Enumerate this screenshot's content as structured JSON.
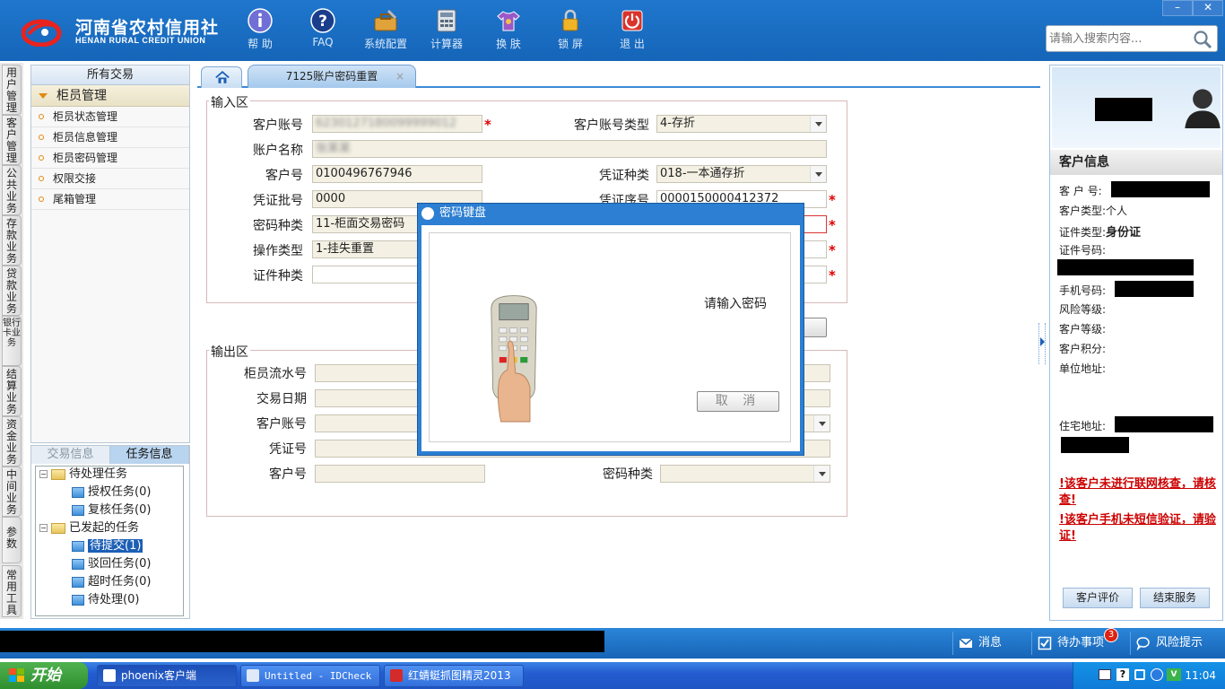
{
  "header": {
    "logo_cn": "河南省农村信用社",
    "logo_en": "HENAN RURAL CREDIT UNION",
    "toolbar": [
      {
        "label": "帮 助",
        "icon": "info-icon"
      },
      {
        "label": "FAQ",
        "icon": "question-icon"
      },
      {
        "label": "系统配置",
        "icon": "toolbox-icon"
      },
      {
        "label": "计算器",
        "icon": "calculator-icon"
      },
      {
        "label": "换 肤",
        "icon": "shirt-icon"
      },
      {
        "label": "锁 屏",
        "icon": "lock-icon"
      },
      {
        "label": "退 出",
        "icon": "power-icon"
      }
    ],
    "search_placeholder": "请输入搜索内容...",
    "win_min": "–",
    "win_close": "✕"
  },
  "vtabs": [
    "用户管理",
    "客户管理",
    "公共业务",
    "存款业务",
    "贷款业务",
    "银行卡业务",
    "结算业务",
    "资金业务",
    "中间业务",
    "参数",
    "常用工具"
  ],
  "menu": {
    "title": "所有交易",
    "group": "柜员管理",
    "items": [
      "柜员状态管理",
      "柜员信息管理",
      "柜员密码管理",
      "权限交接",
      "尾箱管理"
    ]
  },
  "tasks": {
    "tab_txn": "交易信息",
    "tab_task": "任务信息",
    "pending": "待处理任务",
    "pending_items": [
      "授权任务(0)",
      "复核任务(0)"
    ],
    "initiated": "已发起的任务",
    "initiated_items": [
      "待提交(1)",
      "驳回任务(0)",
      "超时任务(0)",
      "待处理(0)"
    ]
  },
  "tab": {
    "title": "7125账户密码重置",
    "close": "×"
  },
  "input_area": {
    "legend": "输入区",
    "fields": {
      "acct_label": "客户账号",
      "acct_value": "6230127180099999012",
      "acct_type_label": "客户账号类型",
      "acct_type_value": "4-存折",
      "acct_name_label": "账户名称",
      "acct_name_value": "张某某",
      "cust_no_label": "客户号",
      "cust_no_value": "0100496767946",
      "voucher_type_label": "凭证种类",
      "voucher_type_value": "018-一本通存折",
      "voucher_batch_label": "凭证批号",
      "voucher_batch_value": "0000",
      "voucher_seq_label": "凭证序号",
      "voucher_seq_value": "0000150000412372",
      "pwd_type_label": "密码种类",
      "pwd_type_value": "11-柜面交易密码",
      "op_type_label": "操作类型",
      "op_type_value": "1-挂失重置",
      "id_type_label": "证件种类",
      "id_type_value": ""
    },
    "required_mark": "*"
  },
  "output_area": {
    "legend": "输出区",
    "fields": {
      "teller_serial_label": "柜员流水号",
      "txn_date_label": "交易日期",
      "acct_label": "客户账号",
      "voucher_label": "凭证号",
      "cust_no_label": "客户号",
      "pwd_type_label": "密码种类"
    }
  },
  "modal": {
    "title": "密码键盘",
    "prompt": "请输入密码",
    "cancel": "取 消"
  },
  "customer": {
    "header": "客户信息",
    "cust_no_label": "客 户 号:",
    "cust_type_label": "客户类型:",
    "cust_type_value": "个人",
    "id_type_label": "证件类型:",
    "id_type_value": "身份证",
    "id_no_label": "证件号码:",
    "phone_label": "手机号码:",
    "risk_label": "风险等级:",
    "level_label": "客户等级:",
    "points_label": "客户积分:",
    "company_label": "单位地址:",
    "home_label": "住宅地址:",
    "warn1": "!该客户未进行联网核查，请核查!",
    "warn2": "!该客户手机未短信验证，请验证!",
    "btn_rate": "客户评价",
    "btn_end": "结束服务"
  },
  "statusbar": {
    "msg": "消息",
    "todo": "待办事项",
    "todo_count": "3",
    "risk": "风险提示"
  },
  "taskbar": {
    "start": "开始",
    "tasks": [
      "phoenix客户端",
      "Untitled - IDCheck",
      "红蜻蜓抓图精灵2013"
    ],
    "clock": "11:04"
  }
}
